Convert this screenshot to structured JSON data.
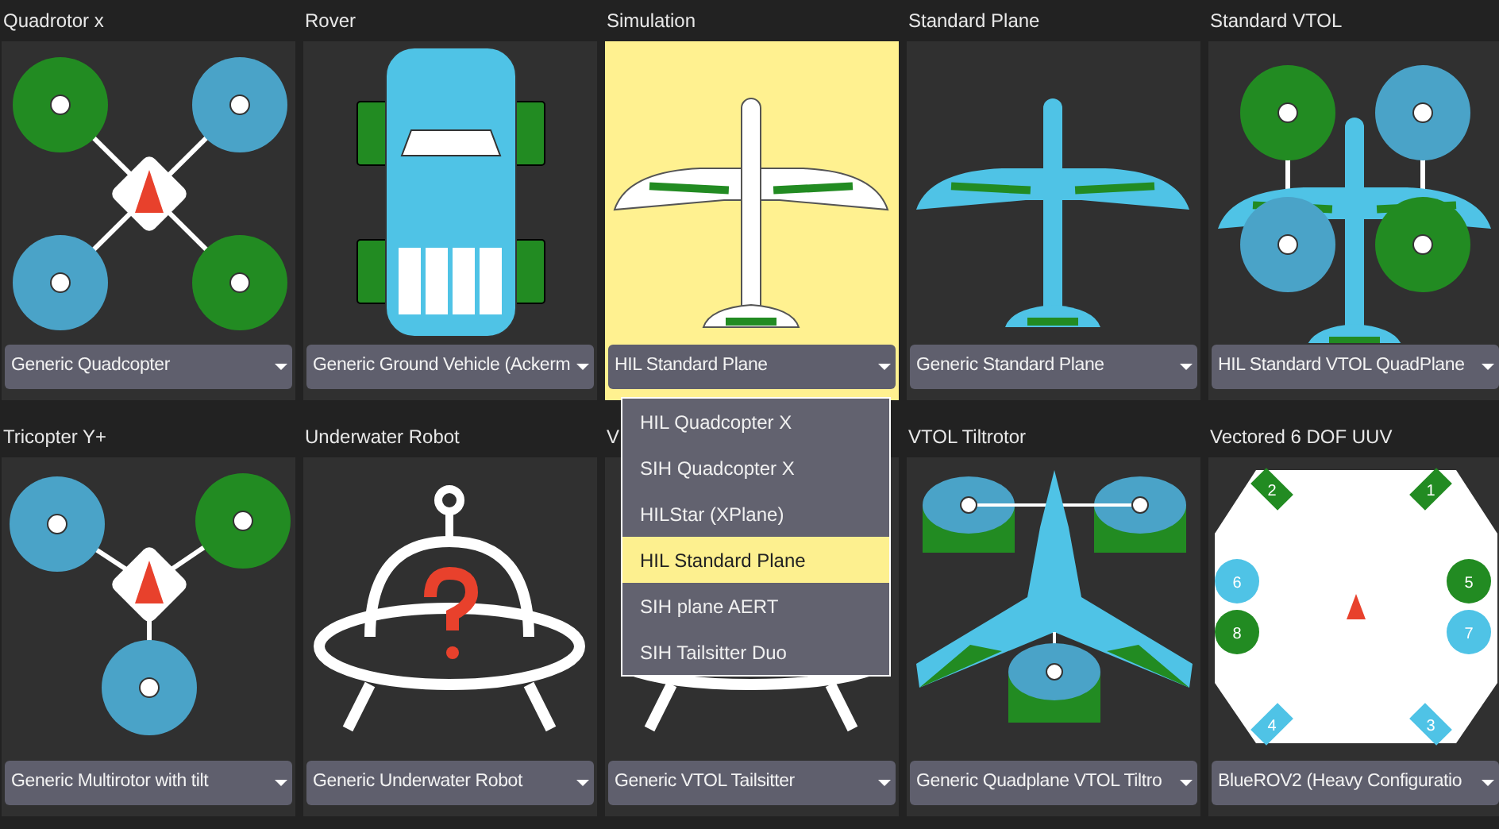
{
  "cards": [
    {
      "title": "Quadrotor x",
      "kind": "quad",
      "selected": false,
      "combo": {
        "value": "Generic Quadcopter"
      }
    },
    {
      "title": "Rover",
      "kind": "rover",
      "selected": false,
      "combo": {
        "value": "Generic Ground Vehicle (Ackerm"
      }
    },
    {
      "title": "Simulation",
      "kind": "simplane",
      "selected": true,
      "combo": {
        "value": "HIL Standard Plane",
        "open": true,
        "options": [
          {
            "label": "HIL Quadcopter X",
            "selected": false
          },
          {
            "label": "SIH Quadcopter X",
            "selected": false
          },
          {
            "label": "HILStar (XPlane)",
            "selected": false
          },
          {
            "label": "HIL Standard Plane",
            "selected": true
          },
          {
            "label": "SIH plane AERT",
            "selected": false
          },
          {
            "label": "SIH Tailsitter Duo",
            "selected": false
          }
        ]
      }
    },
    {
      "title": "Standard Plane",
      "kind": "plane",
      "selected": false,
      "combo": {
        "value": "Generic Standard Plane"
      }
    },
    {
      "title": "Standard VTOL",
      "kind": "vtol",
      "selected": false,
      "combo": {
        "value": "HIL Standard VTOL QuadPlane"
      }
    },
    {
      "title": "Tricopter Y+",
      "kind": "tri",
      "selected": false,
      "combo": {
        "value": "Generic Multirotor with tilt"
      }
    },
    {
      "title": "Underwater Robot",
      "kind": "ufo",
      "selected": false,
      "combo": {
        "value": "Generic Underwater Robot"
      }
    },
    {
      "title": "V",
      "kind": "ufolegs",
      "selected": false,
      "combo": {
        "value": "Generic VTOL Tailsitter"
      }
    },
    {
      "title": "VTOL Tiltrotor",
      "kind": "tiltrotor",
      "selected": false,
      "combo": {
        "value": "Generic Quadplane VTOL Tiltro"
      }
    },
    {
      "title": "Vectored 6 DOF UUV",
      "kind": "rov",
      "selected": false,
      "thruster_labels": [
        "2",
        "1",
        "6",
        "5",
        "8",
        "7",
        "4",
        "3"
      ],
      "combo": {
        "value": "BlueROV2 (Heavy Configuratio"
      }
    }
  ]
}
